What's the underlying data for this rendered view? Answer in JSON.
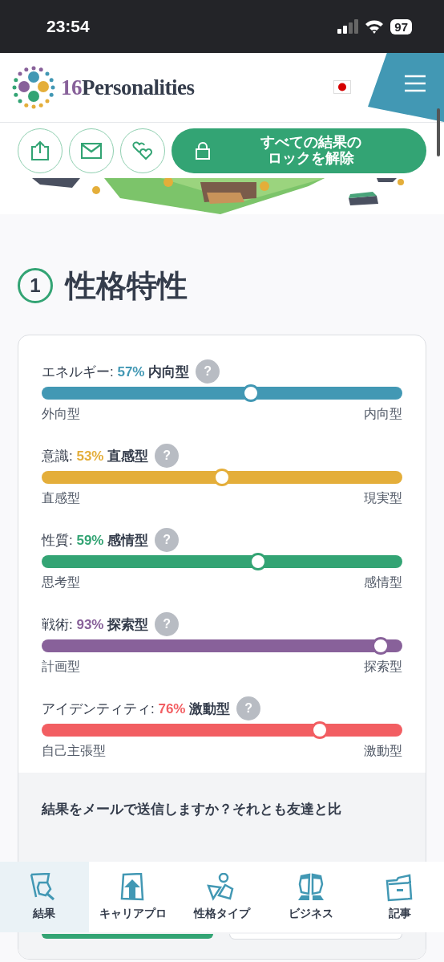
{
  "status_bar": {
    "time": "23:54",
    "battery": "97"
  },
  "header": {
    "logo_number": "16",
    "logo_text": "Personalities"
  },
  "actions": {
    "unlock_button": [
      "すべての結果の",
      "ロックを解除"
    ]
  },
  "section": {
    "number": "1",
    "title": "性格特性"
  },
  "traits": [
    {
      "name": "エネルギー:",
      "percent": "57%",
      "trait": "内向型",
      "help": "?",
      "color": "#4298b4",
      "level": 0.58,
      "left": "外向型",
      "right": "内向型"
    },
    {
      "name": "意識:",
      "percent": "53%",
      "trait": "直感型",
      "help": "?",
      "color": "#e4ae3a",
      "level": 0.5,
      "left": "直感型",
      "right": "現実型"
    },
    {
      "name": "性質:",
      "percent": "59%",
      "trait": "感情型",
      "help": "?",
      "color": "#33a474",
      "level": 0.6,
      "left": "思考型",
      "right": "感情型"
    },
    {
      "name": "戦術:",
      "percent": "93%",
      "trait": "探索型",
      "help": "?",
      "color": "#88619a",
      "level": 0.94,
      "left": "計画型",
      "right": "探索型"
    },
    {
      "name": "アイデンティティ:",
      "percent": "76%",
      "trait": "激動型",
      "help": "?",
      "color": "#f25e62",
      "level": 0.77,
      "left": "自己主張型",
      "right": "激動型"
    }
  ],
  "share": {
    "question": "結果をメールで送信しますか？それとも友達と比"
  },
  "nav": [
    {
      "label": "結果",
      "selected": true
    },
    {
      "label": "キャリアプロ",
      "selected": false
    },
    {
      "label": "性格タイプ",
      "selected": false
    },
    {
      "label": "ビジネス",
      "selected": false
    },
    {
      "label": "記事",
      "selected": false
    }
  ]
}
